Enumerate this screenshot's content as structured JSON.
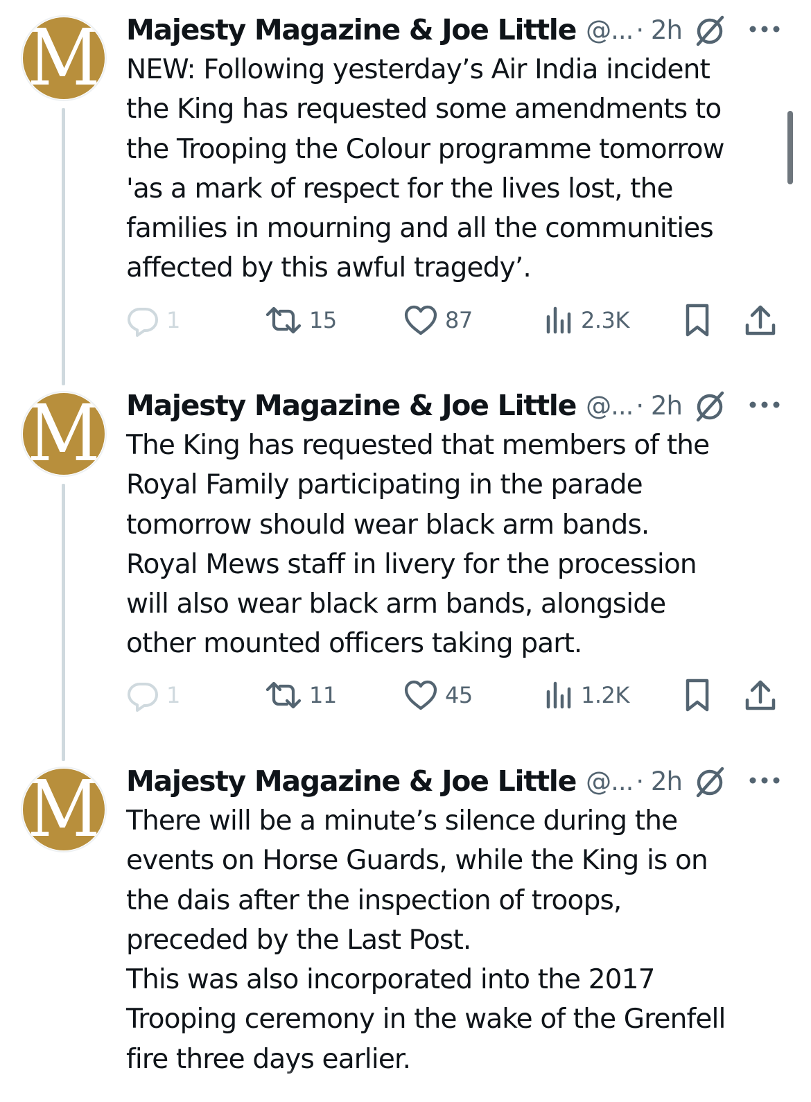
{
  "tweets": [
    {
      "avatar_letter": "M",
      "name": "Majesty Magazine & Joe Little",
      "handle": "@...",
      "time": "· 2h",
      "text": "NEW: Following yesterday’s Air India incident\nthe King has requested some amendments to\nthe Trooping the Colour programme tomorrow\n'as a mark of respect for the lives lost, the\nfamilies in mourning and all the communities\naffected by this awful tragedy’.",
      "replies": "1",
      "reposts": "15",
      "likes": "87",
      "views": "2.3K"
    },
    {
      "avatar_letter": "M",
      "name": "Majesty Magazine & Joe Little",
      "handle": "@...",
      "time": "· 2h",
      "text": "The King has requested that members of the\nRoyal Family participating in the parade\ntomorrow should wear black arm bands.\nRoyal Mews staff in livery for the procession\nwill also wear black arm bands, alongside\nother mounted officers taking part.",
      "replies": "1",
      "reposts": "11",
      "likes": "45",
      "views": "1.2K"
    },
    {
      "avatar_letter": "M",
      "name": "Majesty Magazine & Joe Little",
      "handle": "@...",
      "time": "· 2h",
      "text": "There will be a minute’s silence during the\nevents on Horse Guards, while the King is on\nthe dais after the inspection of troops,\npreceded by the Last Post.\nThis was also incorporated into the 2017\nTrooping ceremony in the wake of the Grenfell\nfire three days earlier."
    }
  ],
  "colors": {
    "avatar_gold": "#b88f3c",
    "secondary_text": "#536471",
    "thread_line": "#cfd9de",
    "primary_text": "#0f1419"
  },
  "icons": [
    "reply-icon",
    "repost-icon",
    "like-icon",
    "views-icon",
    "bookmark-icon",
    "share-icon",
    "grok-icon",
    "more-icon"
  ]
}
